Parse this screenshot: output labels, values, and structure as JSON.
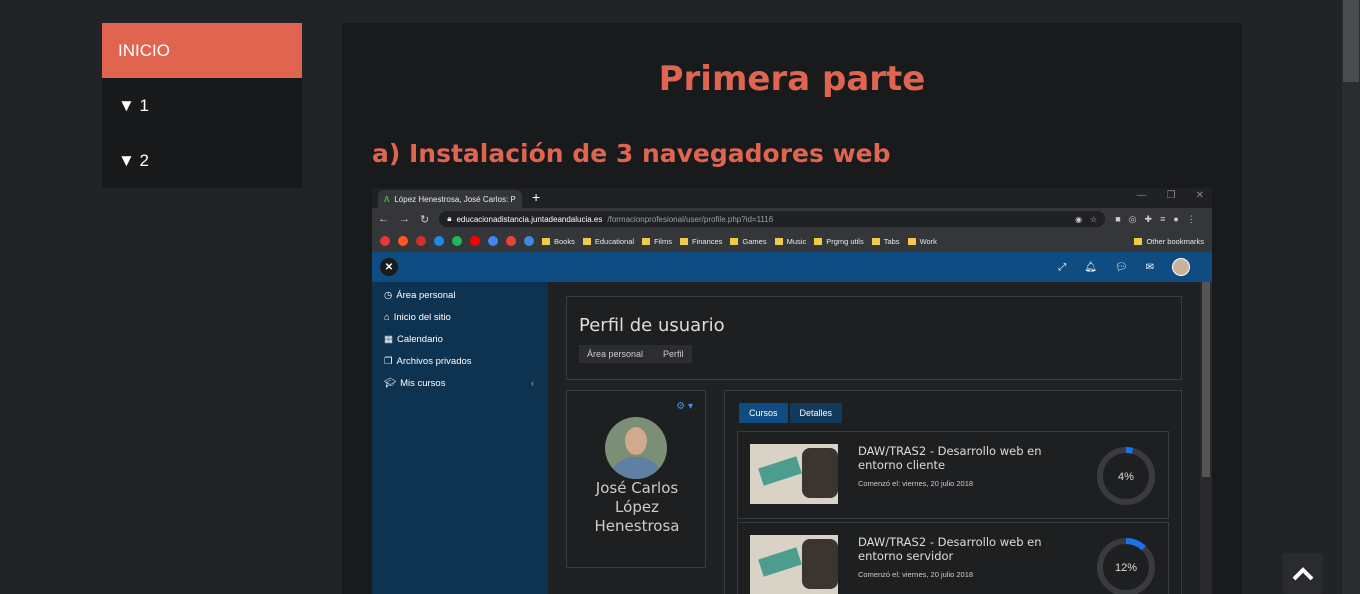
{
  "sidebar": {
    "items": [
      {
        "label": "INICIO"
      },
      {
        "label": "▼ 1"
      },
      {
        "label": "▼ 2"
      }
    ]
  },
  "main": {
    "title": "Primera parte",
    "section_title": "a) Instalación de 3 navegadores web"
  },
  "screenshot": {
    "browser": {
      "tab_title": "López Henestrosa, José Carlos: P",
      "url_host": "educacionadistancia.juntadeandalucia.es",
      "url_path": "/formacionprofesional/user/profile.php?id=1116",
      "bookmarks": [
        "Books",
        "Educational",
        "Films",
        "Finances",
        "Games",
        "Music",
        "Prgmg utils",
        "Tabs",
        "Work"
      ],
      "other_bookmarks": "Other bookmarks"
    },
    "site_nav": [
      {
        "label": "Área personal"
      },
      {
        "label": "Inicio del sitio"
      },
      {
        "label": "Calendario"
      },
      {
        "label": "Archivos privados"
      },
      {
        "label": "Mis cursos"
      }
    ],
    "page_title": "Perfil de usuario",
    "breadcrumb": [
      "Área personal",
      "Perfil"
    ],
    "profile_name": [
      "José Carlos",
      "López",
      "Henestrosa"
    ],
    "course_tabs": [
      "Cursos",
      "Detalles"
    ],
    "courses": [
      {
        "title": "DAW/TRAS2 - Desarrollo web en entorno cliente",
        "started": "Comenzó el: viernes, 20 julio 2018",
        "progress_label": "4%",
        "progress": 0.04
      },
      {
        "title": "DAW/TRAS2 - Desarrollo web en entorno servidor",
        "started": "Comenzó el: viernes, 20 julio 2018",
        "progress_label": "12%",
        "progress": 0.12
      }
    ]
  },
  "colors": {
    "accent": "#e06550",
    "site_blue": "#0f4c81",
    "progress": "#1a73e8"
  }
}
